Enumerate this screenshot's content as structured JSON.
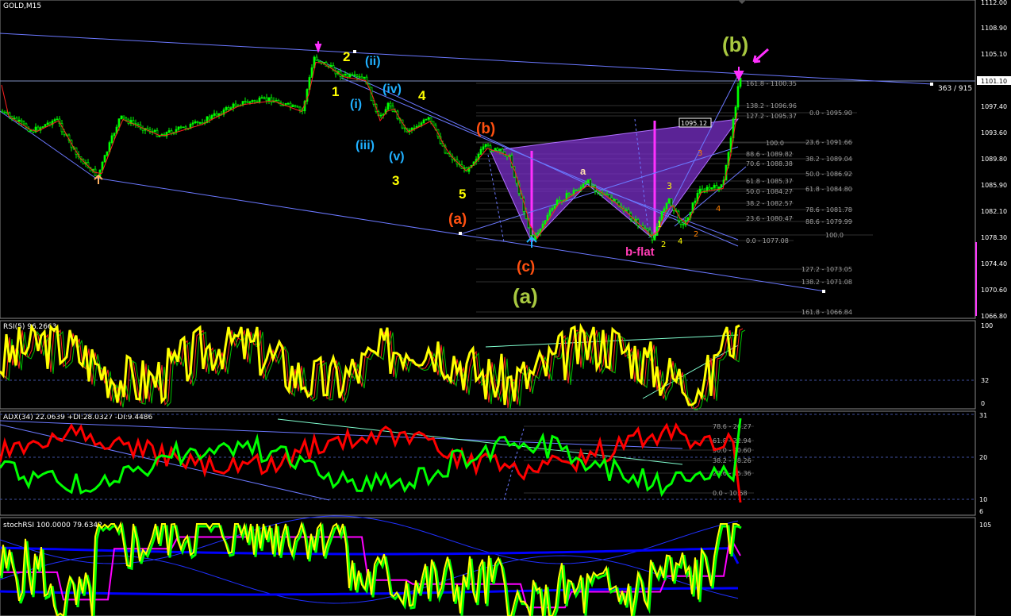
{
  "title": "GOLD,M15",
  "colors": {
    "bg": "#000000",
    "candle": "#00ff00",
    "trend": "#6b78ff",
    "pattern": "#8a2be2",
    "rsi": "#ffff00",
    "adx_plus": "#00ff00",
    "adx_minus": "#ff0000",
    "stoch_main": "#ffff00",
    "stoch_sig": "#ff00ff",
    "stoch_ma": "#0000ff",
    "wave_yellow": "#ffff00",
    "wave_cyan": "#20b0ff",
    "wave_orange": "#ff5010",
    "wave_green": "#a8c840",
    "wave_pink": "#ff3cb4"
  },
  "price_axis": {
    "ticks": [
      "1112.00",
      "1108.90",
      "1105.10",
      "1101.10",
      "1097.40",
      "1093.60",
      "1089.80",
      "1085.90",
      "1082.10",
      "1078.30",
      "1074.40",
      "1070.60",
      "1066.80"
    ],
    "current": "1101.10",
    "mouse_readout": "363 / 915",
    "crosshair_value": "1095.12"
  },
  "fib_labels": [
    "161.8 - 1100.35",
    "138.2 - 1096.96",
    "127.2 - 1095.37",
    "0.0 - 1095.90",
    "100.0",
    "23.6 - 1091.66",
    "88.6 - 1089.82",
    "38.2 - 1089.04",
    "70.6 - 1088.38",
    "50.0 - 1086.92",
    "61.8 - 1085.37",
    "61.8 - 1084.80",
    "50.0 - 1084.27",
    "38.2 - 1082.57",
    "78.6 - 1081.78",
    "23.6 - 1080.47",
    "88.6 - 1079.99",
    "0.0 - 1077.08",
    "100.0",
    "127.2 - 1073.05",
    "138.2 - 1071.08",
    "161.8 - 1066.84"
  ],
  "waves": {
    "w2": "2",
    "w1": "1",
    "wii": "(ii)",
    "wi": "(i)",
    "wiv": "(iv)",
    "wiii": "(iii)",
    "wv": "(v)",
    "w4": "4",
    "w3": "3",
    "w5": "5",
    "wa_small": "(a)",
    "wb_small": "(b)",
    "wc_small": "(c)",
    "wa_big": "(a)",
    "wb_big": "(b)",
    "wa_letter": "a",
    "bflat": "b-flat",
    "n1": "1",
    "n2": "2",
    "n3": "3",
    "n4": "4",
    "n2o": "2",
    "n4o": "4",
    "n3s": "3"
  },
  "rsi": {
    "label": "RSI(5) 96.2663",
    "ticks": [
      "100",
      "32",
      "0"
    ]
  },
  "adx": {
    "label": "ADX(34) 22.0639 +DI:28.0327 -DI:9.4486",
    "ticks": [
      "31",
      "20",
      "10",
      "6"
    ],
    "fib": [
      "78.6 - 26.27",
      "61.8 - 22.94",
      "50.0 - 20.60",
      "38.2 - 18.26",
      "23.6 - 15.36",
      "0.0 - 10.68"
    ]
  },
  "stoch": {
    "label": "stochRSI 100.0000 79.6342",
    "ticks": [
      "105"
    ]
  }
}
